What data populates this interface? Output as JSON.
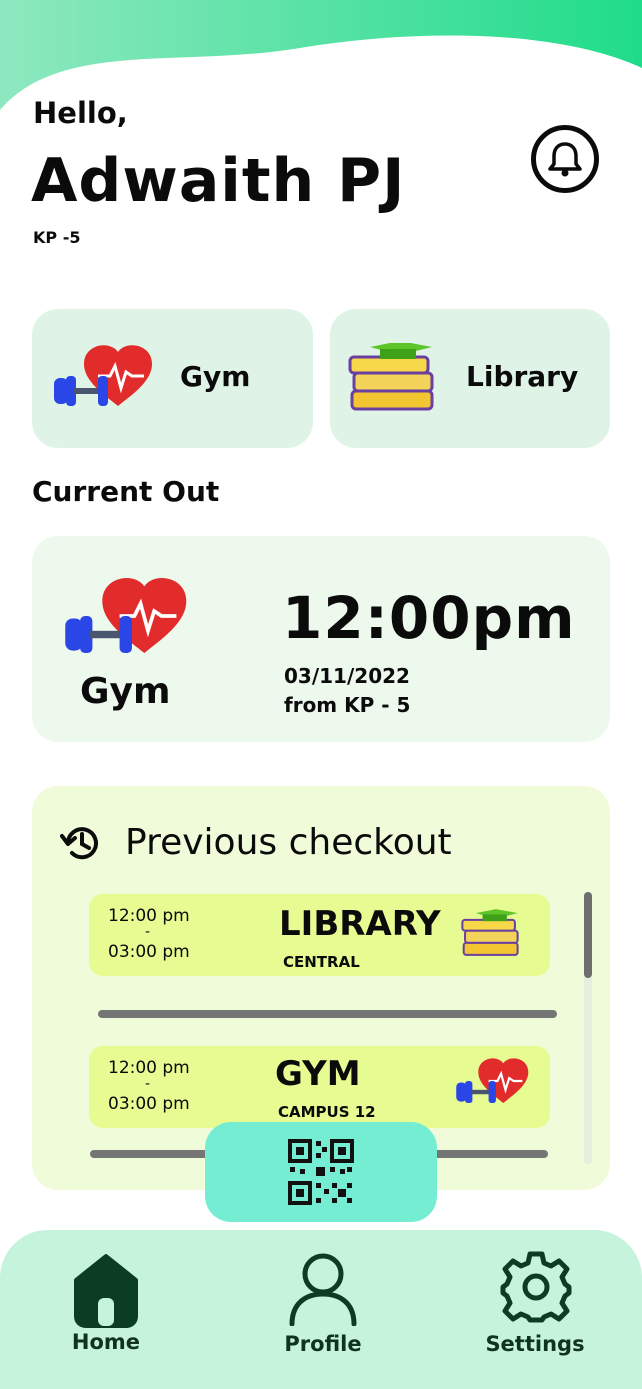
{
  "header": {
    "greeting": "Hello,",
    "user_name": "Adwaith PJ",
    "hostel": "KP -5"
  },
  "quick_actions": [
    {
      "label": "Gym",
      "icon": "gym-dumbbell-heart-icon"
    },
    {
      "label": "Library",
      "icon": "library-books-icon"
    }
  ],
  "current_out": {
    "section_title": "Current Out",
    "place": "Gym",
    "time": "12:00pm",
    "date": "03/11/2022",
    "from": "from KP - 5"
  },
  "previous_checkout": {
    "title": "Previous checkout",
    "entries": [
      {
        "from_time": "12:00  pm",
        "dash": "-",
        "to_time": "03:00 pm",
        "place": "LIBRARY",
        "sub": "CENTRAL",
        "icon": "library-books-icon"
      },
      {
        "from_time": "12:00  pm",
        "dash": "-",
        "to_time": "03:00 pm",
        "place": "GYM",
        "sub": "CAMPUS 12",
        "icon": "gym-dumbbell-heart-icon"
      }
    ]
  },
  "nav": {
    "home": "Home",
    "profile": "Profile",
    "settings": "Settings"
  },
  "colors": {
    "wave_start": "#8ee8bf",
    "wave_end": "#1fdc8a",
    "card_green": "#dff4e6",
    "current_card": "#eef9ee",
    "previous_card": "#effbd9",
    "entry_bg": "#e6fb91",
    "qr_button": "#74edd2",
    "nav_bg": "#c5f3dc",
    "nav_icon": "#0e4a2c"
  }
}
